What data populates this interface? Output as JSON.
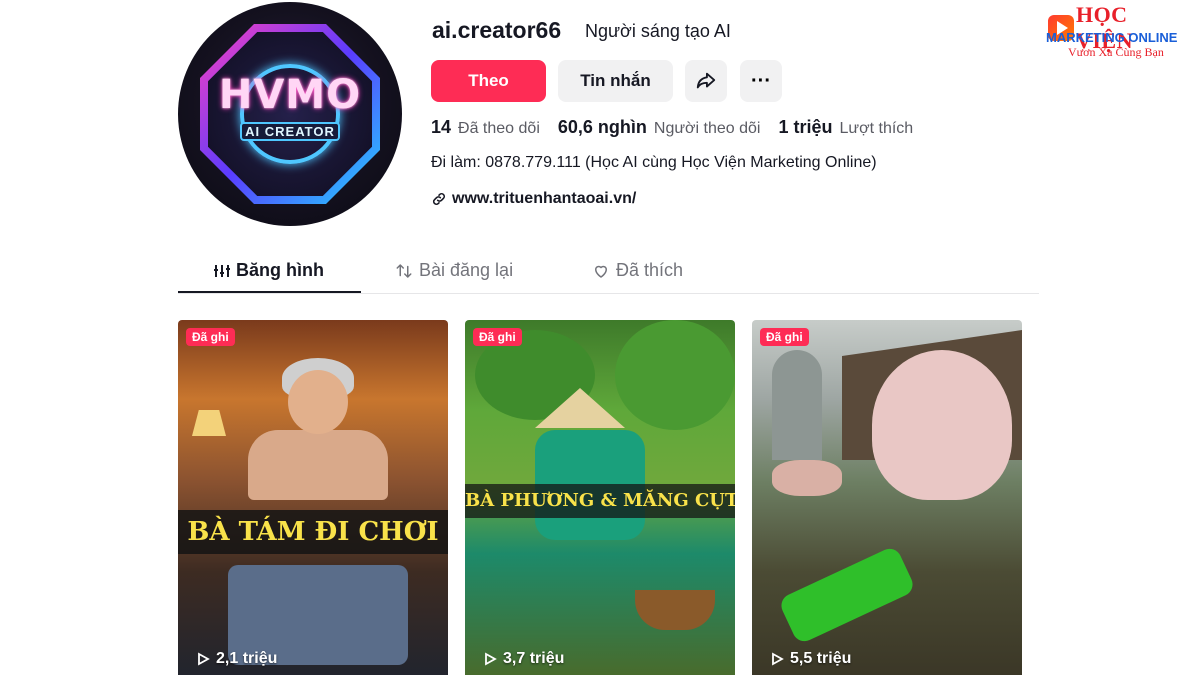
{
  "watermark": {
    "line1": "HỌC VIỆN",
    "line2": "MARKETING ONLINE",
    "slogan": "Vươn Xa Cùng Bạn"
  },
  "avatar": {
    "title": "HVMO",
    "subtitle": "AI CREATOR"
  },
  "profile": {
    "username": "ai.creator66",
    "nickname": "Người sáng tạo AI",
    "bio": "Đi làm: 0878.779.111 (Học AI cùng Học Viện Marketing Online)",
    "link": "www.trituenhantaoai.vn/"
  },
  "actions": {
    "follow": "Theo",
    "message": "Tin nhắn",
    "share_icon": "share-icon",
    "more": "···"
  },
  "stats": [
    {
      "value": "14",
      "label": "Đã theo dõi"
    },
    {
      "value": "60,6 nghìn",
      "label": "Người theo dõi"
    },
    {
      "value": "1 triệu",
      "label": "Lượt thích"
    }
  ],
  "tabs": [
    {
      "label": "Băng hình",
      "icon": "grid-icon",
      "active": true
    },
    {
      "label": "Bài đăng lại",
      "icon": "repost-icon",
      "active": false
    },
    {
      "label": "Đã thích",
      "icon": "heart-icon",
      "active": false
    }
  ],
  "videos": [
    {
      "badge": "Đã ghi",
      "title": "BÀ TÁM ĐI CHƠI",
      "views": "2,1 triệu"
    },
    {
      "badge": "Đã ghi",
      "title": "BÀ PHƯƠNG & MĂNG CỤT",
      "views": "3,7 triệu"
    },
    {
      "badge": "Đã ghi",
      "title": "",
      "views": "5,5 triệu"
    }
  ],
  "colors": {
    "accent": "#fe2c55",
    "text": "#161823",
    "secondary_text": "#73747b",
    "button_bg": "#f1f1f2"
  }
}
